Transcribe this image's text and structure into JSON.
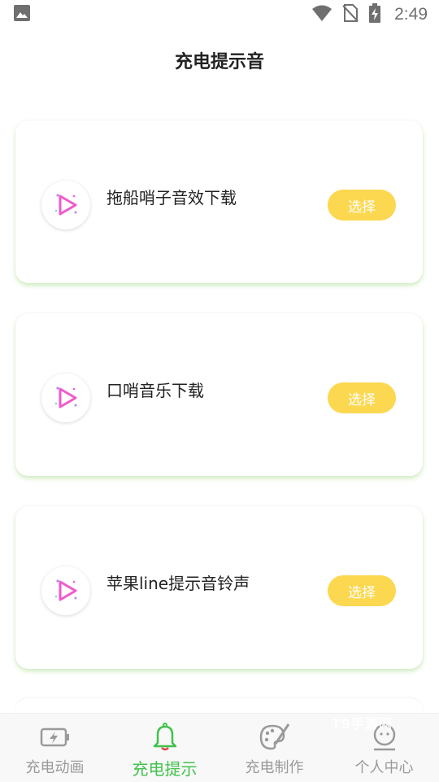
{
  "status_bar": {
    "time": "2:49",
    "icons": [
      "image-icon",
      "wifi-icon",
      "no-sim-icon",
      "battery-charging-icon"
    ]
  },
  "header": {
    "title": "充电提示音"
  },
  "sounds": [
    {
      "name": "拖船哨子音效下载",
      "button_label": "选择",
      "icon": "play-icon"
    },
    {
      "name": "口哨音乐下载",
      "button_label": "选择",
      "icon": "play-icon"
    },
    {
      "name": "苹果line提示音铃声",
      "button_label": "选择",
      "icon": "play-icon"
    }
  ],
  "tabs": [
    {
      "label": "充电动画",
      "icon": "battery-charging-icon",
      "active": false
    },
    {
      "label": "充电提示",
      "icon": "bell-icon",
      "active": true
    },
    {
      "label": "充电制作",
      "icon": "palette-icon",
      "active": false
    },
    {
      "label": "个人中心",
      "icon": "person-icon",
      "active": false
    }
  ],
  "watermark": "T9手游网",
  "colors": {
    "accent_green": "#41c24b",
    "button_yellow": "#fcd850",
    "play_pink": "#f25acb"
  }
}
